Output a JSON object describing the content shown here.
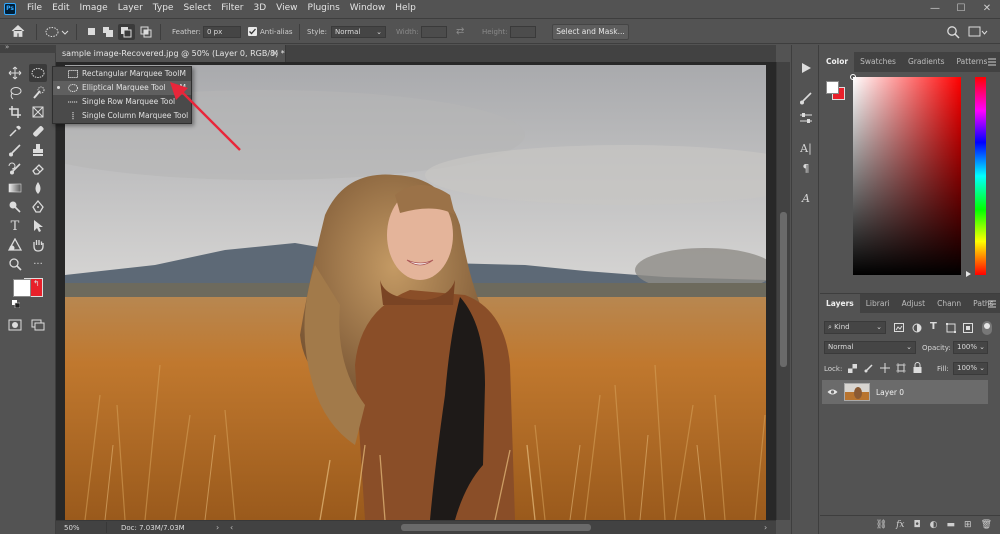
{
  "app": {
    "logo": "Ps"
  },
  "menu": [
    "File",
    "Edit",
    "Image",
    "Layer",
    "Type",
    "Select",
    "Filter",
    "3D",
    "View",
    "Plugins",
    "Window",
    "Help"
  ],
  "window_controls": {
    "minimize": "—",
    "maximize": "☐",
    "close": "✕"
  },
  "options": {
    "feather_label": "Feather:",
    "feather_value": "0 px",
    "antialias_label": "Anti-alias",
    "antialias_checked": true,
    "style_label": "Style:",
    "style_value": "Normal",
    "width_label": "Width:",
    "height_label": "Height:",
    "select_mask_label": "Select and Mask..."
  },
  "document_tab": {
    "title": "sample image-Recovered.jpg @ 50% (Layer 0, RGB/8) *",
    "close": "×"
  },
  "status": {
    "zoom": "50%",
    "doc": "Doc: 7.03M/7.03M"
  },
  "flyout": [
    {
      "label": "Rectangular Marquee Tool",
      "key": "M",
      "icon": "rect-marquee-icon",
      "selected": false
    },
    {
      "label": "Elliptical Marquee Tool",
      "key": "M",
      "icon": "ellipse-marquee-icon",
      "selected": true
    },
    {
      "label": "Single Row Marquee Tool",
      "key": "",
      "icon": "single-row-icon",
      "selected": false
    },
    {
      "label": "Single Column Marquee Tool",
      "key": "",
      "icon": "single-column-icon",
      "selected": false
    }
  ],
  "color_panel": {
    "tabs": [
      "Color",
      "Swatches",
      "Gradients",
      "Patterns"
    ],
    "foreground": "#ffffff",
    "background": "#e8202a",
    "hue": "#ff0000"
  },
  "layers_panel": {
    "tabs": [
      "Layers",
      "Librari",
      "Adjust",
      "Chann",
      "Paths"
    ],
    "kind_label": "Kind",
    "blend_mode": "Normal",
    "opacity_label": "Opacity:",
    "opacity_value": "100%",
    "lock_label": "Lock:",
    "fill_label": "Fill:",
    "fill_value": "100%",
    "layers": [
      {
        "name": "Layer 0",
        "visible": true
      }
    ]
  },
  "colors": {
    "ui_bg": "#535353",
    "ui_dark": "#424242",
    "canvas_bg": "#282828",
    "accent_red": "#e8202a",
    "arrow": "#e8263a"
  }
}
